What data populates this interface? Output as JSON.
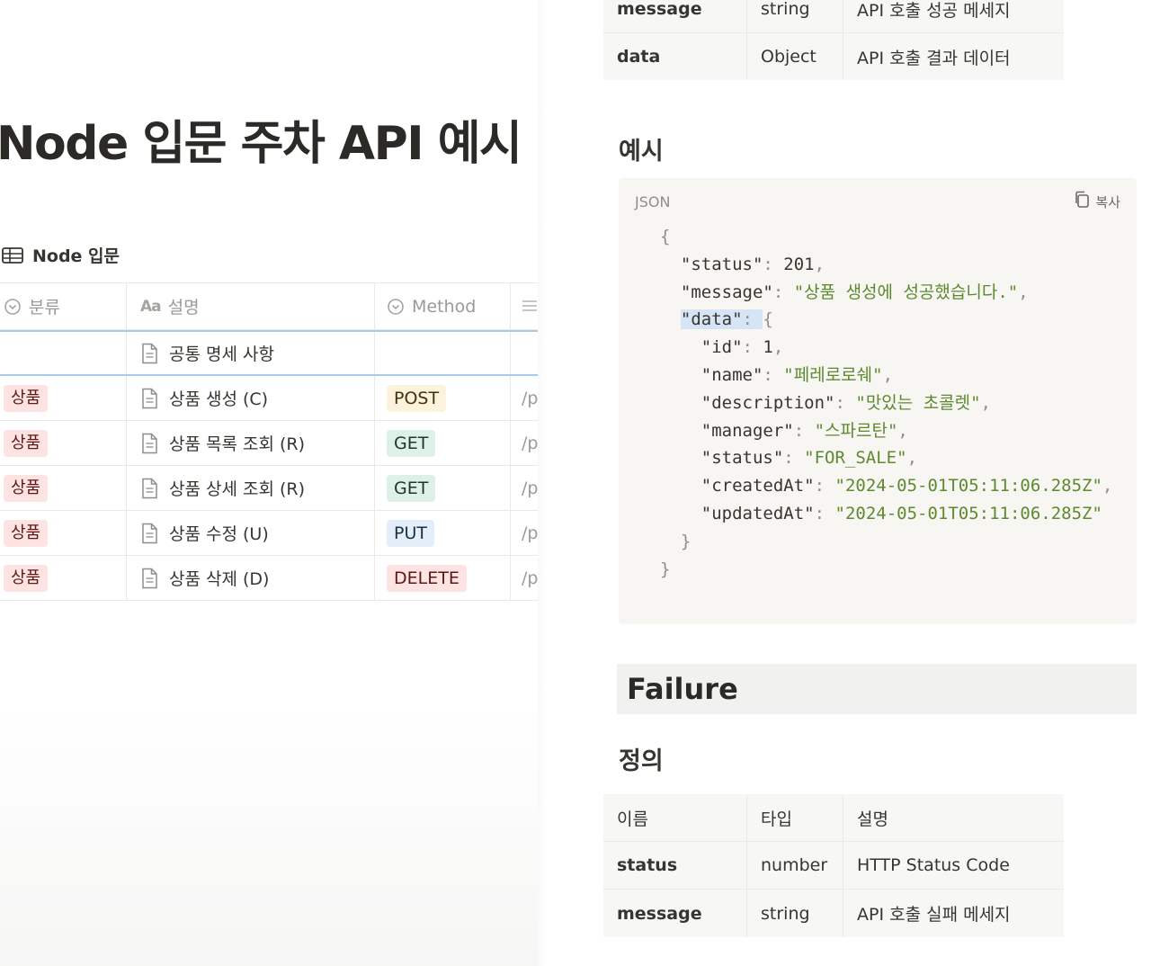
{
  "left": {
    "page_title": "Node 입문 주차 API 예시",
    "database_title": "Node 입문",
    "columns": {
      "category": "분류",
      "description_prefix": "Aa",
      "description": "설명",
      "method": "Method"
    },
    "rows": [
      {
        "category": "",
        "title": "공통 명세 사항",
        "method": "",
        "method_style": "",
        "path": ""
      },
      {
        "category": "상품",
        "title": "상품 생성 (C)",
        "method": "POST",
        "method_style": "post",
        "path": "/p"
      },
      {
        "category": "상품",
        "title": "상품 목록 조회 (R)",
        "method": "GET",
        "method_style": "get",
        "path": "/p"
      },
      {
        "category": "상품",
        "title": "상품 상세 조회 (R)",
        "method": "GET",
        "method_style": "get",
        "path": "/p"
      },
      {
        "category": "상품",
        "title": "상품 수정 (U)",
        "method": "PUT",
        "method_style": "put",
        "path": "/p"
      },
      {
        "category": "상품",
        "title": "상품 삭제 (D)",
        "method": "DELETE",
        "method_style": "delete",
        "path": "/p"
      }
    ]
  },
  "right": {
    "success_table_rows": [
      {
        "name": "message",
        "type": "string",
        "desc": "API 호출 성공 메세지"
      },
      {
        "name": "data",
        "type": "Object",
        "desc": "API 호출 결과 데이터"
      }
    ],
    "example_heading": "예시",
    "code": {
      "language": "JSON",
      "copy_label": "복사",
      "open_brace": "{",
      "close_brace": "}",
      "inner_close": "}",
      "status_key": "\"status\"",
      "status_value": "201",
      "message_key": "\"message\"",
      "message_value": "\"상품 생성에 성공했습니다.\"",
      "data_key": "\"data\"",
      "data_open": "{",
      "fields": [
        {
          "key": "\"id\"",
          "value": "1",
          "is_string": false
        },
        {
          "key": "\"name\"",
          "value": "\"페레로로쉐\"",
          "is_string": true
        },
        {
          "key": "\"description\"",
          "value": "\"맛있는 초콜렛\"",
          "is_string": true
        },
        {
          "key": "\"manager\"",
          "value": "\"스파르탄\"",
          "is_string": true
        },
        {
          "key": "\"status\"",
          "value": "\"FOR_SALE\"",
          "is_string": true
        },
        {
          "key": "\"createdAt\"",
          "value": "\"2024-05-01T05:11:06.285Z\"",
          "is_string": true
        },
        {
          "key": "\"updatedAt\"",
          "value": "\"2024-05-01T05:11:06.285Z\"",
          "is_string": true
        }
      ]
    },
    "failure_heading": "Failure",
    "definition_heading": "정의",
    "failure_table": {
      "headers": {
        "name": "이름",
        "type": "타입",
        "desc": "설명"
      },
      "rows": [
        {
          "name": "status",
          "type": "number",
          "desc": "HTTP Status Code"
        },
        {
          "name": "message",
          "type": "string",
          "desc": "API 호출 실패 메세지"
        }
      ]
    }
  }
}
